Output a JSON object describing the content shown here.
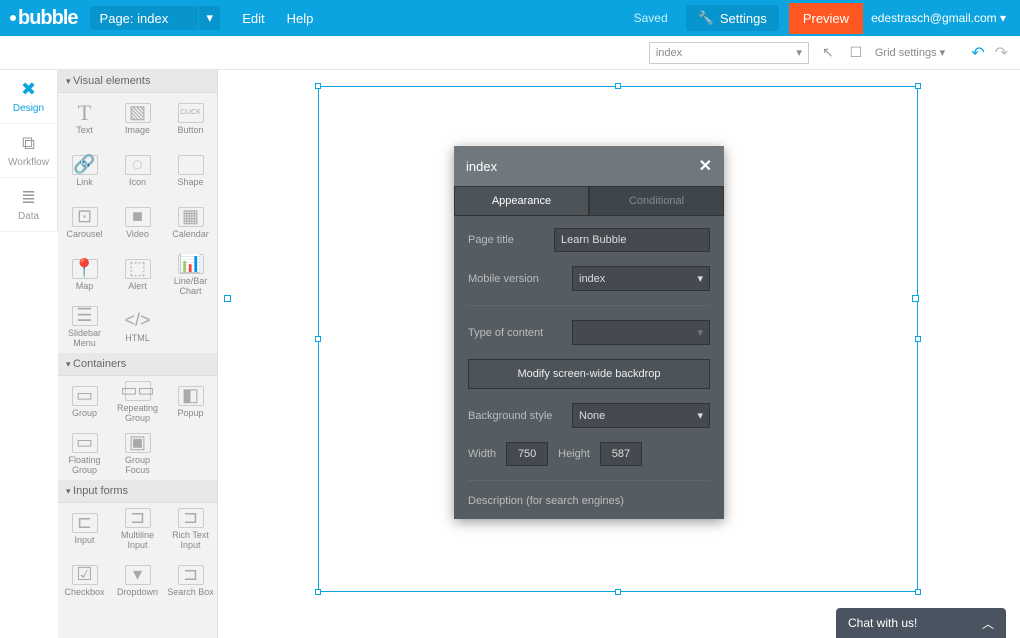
{
  "topbar": {
    "logo": "bubble",
    "page_selector": "Page: index",
    "edit": "Edit",
    "help": "Help",
    "saved": "Saved",
    "settings": "Settings",
    "preview": "Preview",
    "user": "edestrasch@gmail.com"
  },
  "subbar": {
    "dropdown": "index",
    "gridsettings": "Grid settings"
  },
  "leftnav": {
    "design": "Design",
    "workflow": "Workflow",
    "data": "Data"
  },
  "palette": {
    "section_visual": "Visual elements",
    "section_containers": "Containers",
    "section_input": "Input forms",
    "items": {
      "text": "Text",
      "image": "Image",
      "button": "Button",
      "link": "Link",
      "icon": "Icon",
      "shape": "Shape",
      "carousel": "Carousel",
      "video": "Video",
      "calendar": "Calendar",
      "map": "Map",
      "alert": "Alert",
      "chart": "Line/Bar Chart",
      "slidebar": "Slidebar Menu",
      "html": "HTML",
      "group": "Group",
      "rgroup": "Repeating Group",
      "popup": "Popup",
      "fgroup": "Floating Group",
      "gfocus": "Group Focus",
      "input": "Input",
      "multiline": "Multiline Input",
      "richtext": "Rich Text Input",
      "checkbox": "Checkbox",
      "dropdown": "Dropdown",
      "searchbox": "Search Box"
    }
  },
  "ppanel": {
    "title": "index",
    "tab_appearance": "Appearance",
    "tab_conditional": "Conditional",
    "page_title_label": "Page title",
    "page_title_value": "Learn Bubble",
    "mobile_label": "Mobile version",
    "mobile_value": "index",
    "type_label": "Type of content",
    "backdrop_btn": "Modify screen-wide backdrop",
    "bg_label": "Background style",
    "bg_value": "None",
    "width_label": "Width",
    "width_value": "750",
    "height_label": "Height",
    "height_value": "587",
    "desc_label": "Description (for search engines)"
  },
  "chat": "Chat with us!"
}
